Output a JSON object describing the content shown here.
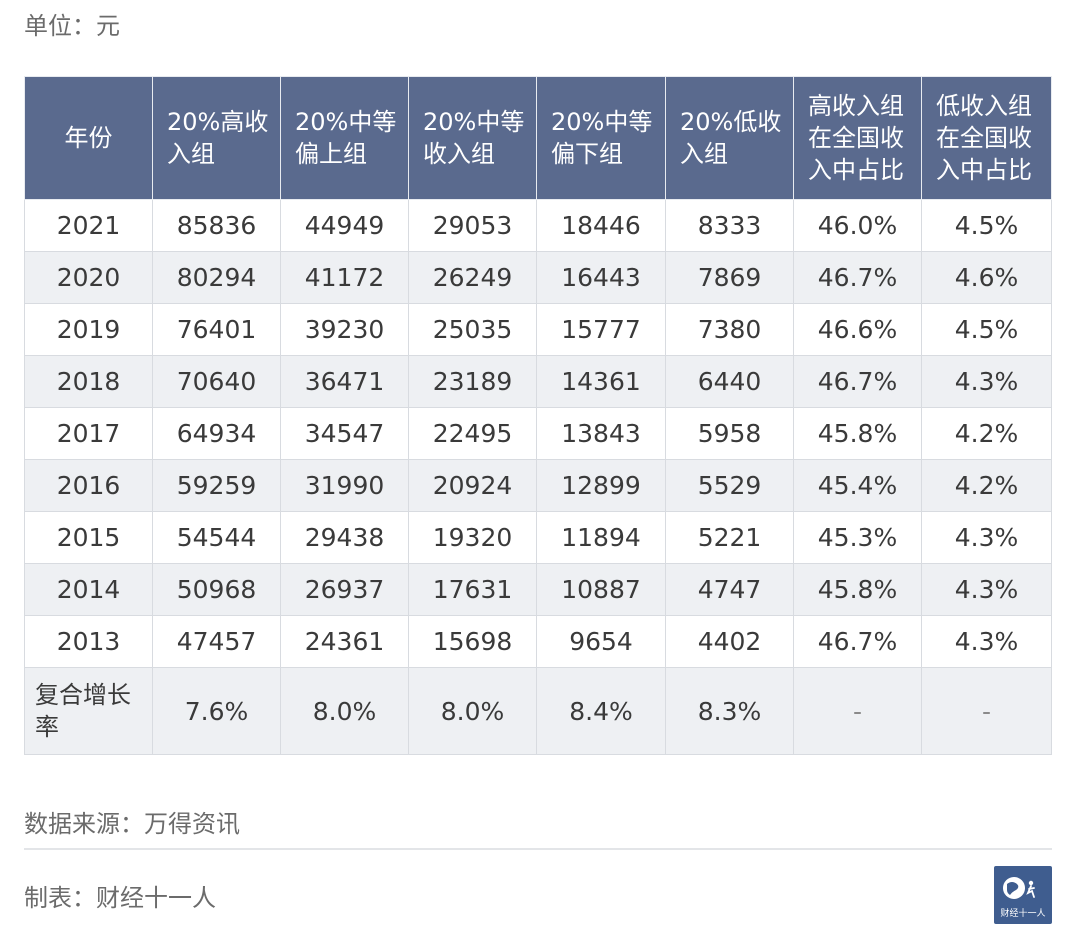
{
  "unit_label": "单位：元",
  "table": {
    "headers": [
      [
        "年份"
      ],
      [
        "20%高收",
        "入组"
      ],
      [
        "20%中等",
        "偏上组"
      ],
      [
        "20%中等",
        "收入组"
      ],
      [
        "20%中等",
        "偏下组"
      ],
      [
        "20%低收",
        "入组"
      ],
      [
        "高收入组",
        "在全国收",
        "入中占比"
      ],
      [
        "低收入组",
        "在全国收",
        "入中占比"
      ]
    ],
    "rows": [
      [
        "2021",
        "85836",
        "44949",
        "29053",
        "18446",
        "8333",
        "46.0%",
        "4.5%"
      ],
      [
        "2020",
        "80294",
        "41172",
        "26249",
        "16443",
        "7869",
        "46.7%",
        "4.6%"
      ],
      [
        "2019",
        "76401",
        "39230",
        "25035",
        "15777",
        "7380",
        "46.6%",
        "4.5%"
      ],
      [
        "2018",
        "70640",
        "36471",
        "23189",
        "14361",
        "6440",
        "46.7%",
        "4.3%"
      ],
      [
        "2017",
        "64934",
        "34547",
        "22495",
        "13843",
        "5958",
        "45.8%",
        "4.2%"
      ],
      [
        "2016",
        "59259",
        "31990",
        "20924",
        "12899",
        "5529",
        "45.4%",
        "4.2%"
      ],
      [
        "2015",
        "54544",
        "29438",
        "19320",
        "11894",
        "5221",
        "45.3%",
        "4.3%"
      ],
      [
        "2014",
        "50968",
        "26937",
        "17631",
        "10887",
        "4747",
        "45.8%",
        "4.3%"
      ],
      [
        "2013",
        "47457",
        "24361",
        "15698",
        "9654",
        "4402",
        "46.7%",
        "4.3%"
      ]
    ],
    "cagr_row": {
      "label": [
        "复合增长",
        "率"
      ],
      "values": [
        "7.6%",
        "8.0%",
        "8.0%",
        "8.4%",
        "8.3%",
        "-",
        "-"
      ]
    }
  },
  "source_label": "数据来源：万得资讯",
  "maker_label": "制表：财经十一人",
  "logo": {
    "text": "财经十一人",
    "background": "#3f5d8f"
  },
  "colors": {
    "header_bg": "#5a6a8e",
    "stripe_bg": "#eef0f3"
  }
}
